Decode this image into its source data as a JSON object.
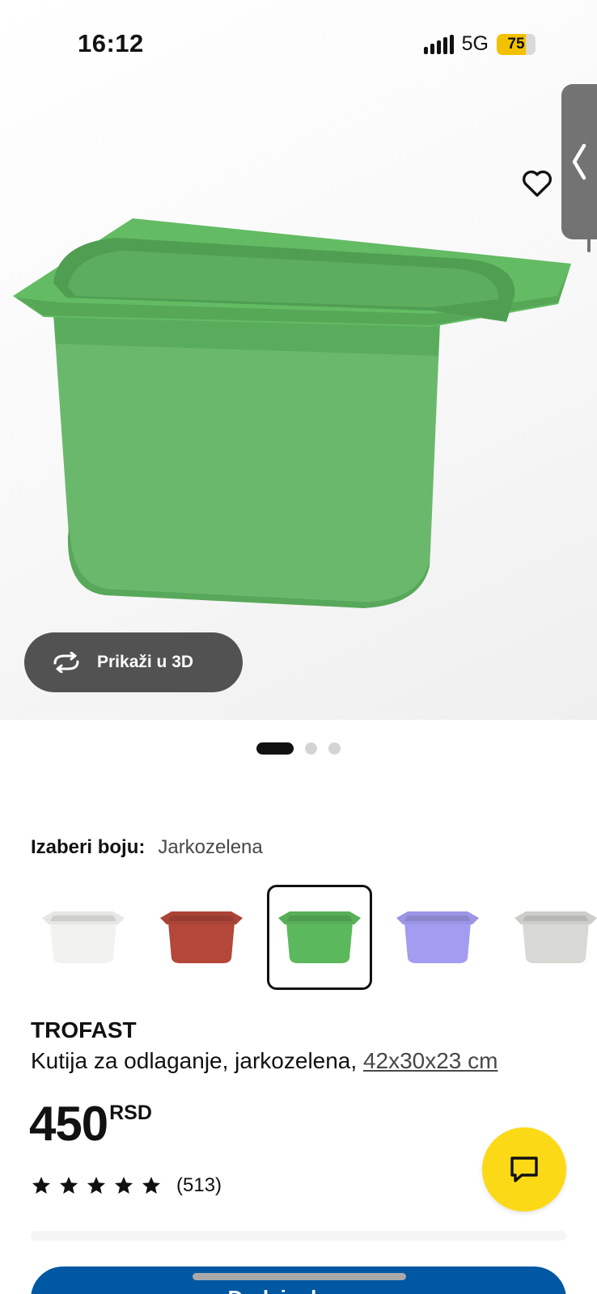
{
  "status_bar": {
    "time": "16:12",
    "network": "5G",
    "battery": "75",
    "battery_level": 0.75,
    "battery_color": "#f2c200"
  },
  "hero": {
    "favorite_icon": "heart-outline-icon",
    "side_tab_icon": "chevron-left-icon",
    "view_3d_label": "Prikaži u 3D",
    "view_3d_icon": "rotate-arrows-icon",
    "carousel": {
      "count": 3,
      "active": 0
    }
  },
  "color_picker": {
    "label": "Izaberi boju:",
    "selected": "Jarkozelena",
    "options": [
      {
        "color": "#f2f2f0"
      },
      {
        "color": "#b3473a"
      },
      {
        "color": "#5cb85c",
        "selected": true
      },
      {
        "color": "#a49cf0"
      },
      {
        "color": "#d8d8d4"
      }
    ]
  },
  "product": {
    "name": "TROFAST",
    "description": "Kutija za odlaganje, jarkozelena, ",
    "dimensions": "42x30x23 cm",
    "price": "450",
    "currency": "RSD",
    "rating_stars": 5,
    "review_count": "(513)"
  },
  "actions": {
    "buy_label": "Dodaj u korpu",
    "chat_icon": "chat-bubble-icon"
  },
  "colors": {
    "accent_blue": "#0058a3",
    "accent_yellow": "#fcd917",
    "product_green": "#5cb85c"
  }
}
